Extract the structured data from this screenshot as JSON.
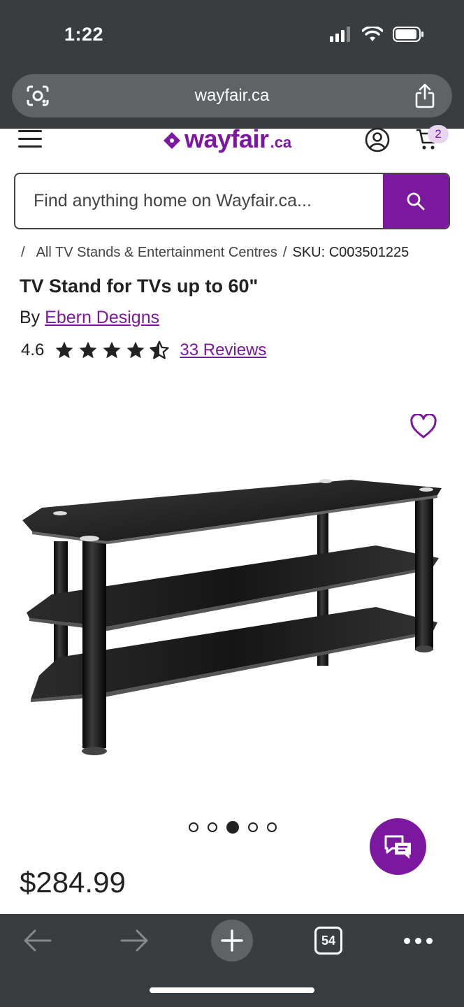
{
  "status_bar": {
    "time": "1:22"
  },
  "browser": {
    "url": "wayfair.ca",
    "tab_count": "54"
  },
  "header": {
    "logo_word": "wayfair",
    "logo_suffix": ".ca",
    "cart_count": "2"
  },
  "search": {
    "placeholder": "Find anything home on Wayfair.ca..."
  },
  "breadcrumb": {
    "sep": "/",
    "category": "All TV Stands & Entertainment Centres",
    "sku": "SKU: C003501225"
  },
  "product": {
    "title": "TV Stand for TVs up to 60\"",
    "by_prefix": "By",
    "brand": "Ebern Designs",
    "rating": "4.6",
    "rating_value": 4.6,
    "rating_max": 5,
    "reviews": "33 Reviews",
    "price": "$284.99"
  },
  "carousel": {
    "count": 5,
    "active_index": 2
  },
  "colors": {
    "brand": "#7b189f",
    "chrome": "#3a3d3f",
    "badge_bg": "#e8d6f1"
  },
  "icons": {
    "url_left": "lens-icon",
    "url_right": "share-icon",
    "menu": "hamburger-icon",
    "account": "account-icon",
    "cart": "cart-icon",
    "search": "search-icon",
    "favorite": "heart-icon",
    "chat": "chat-icon",
    "back": "back-arrow-icon",
    "forward": "forward-arrow-icon",
    "new_tab": "plus-icon",
    "more": "more-icon"
  }
}
